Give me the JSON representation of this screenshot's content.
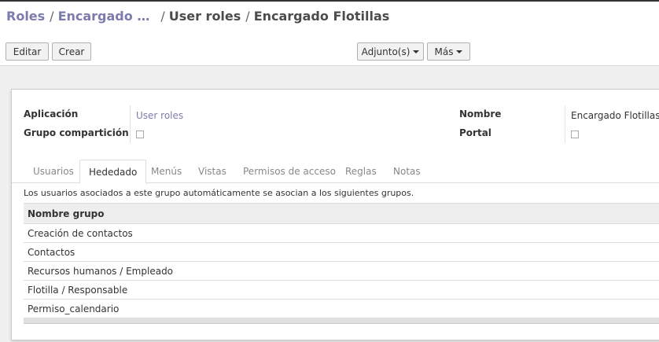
{
  "breadcrumb": {
    "items": [
      "Roles",
      "Encargado …",
      "User roles"
    ],
    "current": "Encargado Flotillas"
  },
  "toolbar": {
    "edit_label": "Editar",
    "create_label": "Crear",
    "attachments_label": "Adjunto(s)",
    "more_label": "Más"
  },
  "form": {
    "application_label": "Aplicación",
    "application_value": "User roles",
    "share_group_label": "Grupo compartición",
    "name_label": "Nombre",
    "name_value": "Encargado Flotillas",
    "portal_label": "Portal"
  },
  "tabs": [
    {
      "label": "Usuarios",
      "active": false
    },
    {
      "label": "Hededado",
      "active": true
    },
    {
      "label": "Menús",
      "active": false
    },
    {
      "label": "Vistas",
      "active": false
    },
    {
      "label": "Permisos de acceso",
      "active": false
    },
    {
      "label": "Reglas",
      "active": false
    },
    {
      "label": "Notas",
      "active": false
    }
  ],
  "inherited": {
    "description": "Los usuarios asociados a este grupo automáticamente se asocian a los siguientes grupos.",
    "column_header": "Nombre grupo",
    "rows": [
      "Creación de contactos",
      "Contactos",
      "Recursos humanos / Empleado",
      "Flotilla / Responsable",
      "Permiso_calendario"
    ]
  },
  "colors": {
    "link": "#7c7bad",
    "text": "#4c4c4c"
  }
}
